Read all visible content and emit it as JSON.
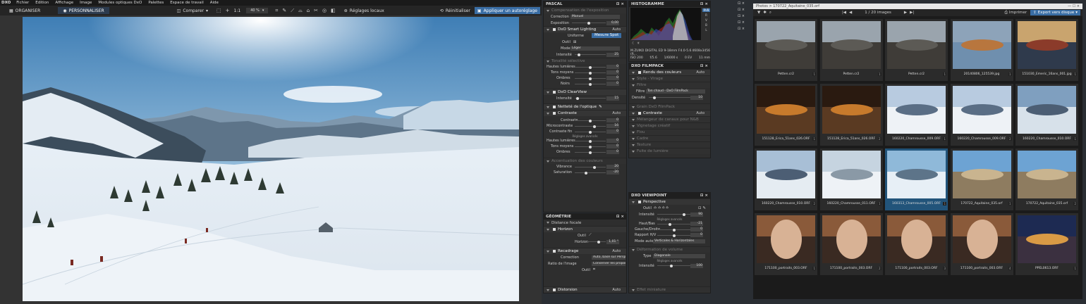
{
  "menubar": {
    "logo": "DXO",
    "items": [
      "Fichier",
      "Edition",
      "Affichage",
      "Image",
      "Modules optiques DxO",
      "Palettes",
      "Espace de travail",
      "Aide"
    ]
  },
  "toolbar": {
    "organize": "ORGANISER",
    "customize": "PERSONNALISER",
    "compare": "Comparer",
    "fit": "1:1",
    "zoom": "40 %",
    "local": "Réglages locaux",
    "reset": "Réinitialiser",
    "apply": "Appliquer un autoréglage"
  },
  "pascal": {
    "title": "PASCAL",
    "exposure_comp": "Compensation de l'exposition",
    "correction_label": "Correction",
    "correction_value": "Manuel",
    "exposure_label": "Exposition",
    "exposure_value": "0,00",
    "smart_lighting": "DxO Smart Lighting",
    "auto": "Auto",
    "uniform": "Uniforme",
    "spot": "Mesure Spot",
    "tool_label": "Outil",
    "mode_label": "Mode",
    "mode_value": "Léger",
    "intensity_label": "Intensité",
    "intensity_value": "25",
    "selective_tone": "Tonalité sélective",
    "tones": [
      {
        "label": "Hautes lumières",
        "value": "0"
      },
      {
        "label": "Tons moyens",
        "value": "0"
      },
      {
        "label": "Ombres",
        "value": "0"
      },
      {
        "label": "Noirs",
        "value": "0"
      }
    ],
    "clearview": "DxO ClearView",
    "clearview_intensity": "15",
    "sharpness": "Netteté de l'optique",
    "contrast": "Contraste",
    "contrast_rows": [
      {
        "label": "Contraste",
        "value": "0"
      },
      {
        "label": "Microcontraste",
        "value": "16"
      },
      {
        "label": "Contraste fin",
        "value": "0"
      }
    ],
    "advanced": "Réglages avancés",
    "contrast_adv": [
      {
        "label": "Hautes lumières",
        "value": "0"
      },
      {
        "label": "Tons moyens",
        "value": "0"
      },
      {
        "label": "Ombres",
        "value": "0"
      }
    ],
    "color_accent": "Accentuation des couleurs",
    "vibrance_label": "Vibrance",
    "vibrance_value": "20",
    "saturation_label": "Saturation",
    "saturation_value": "-20"
  },
  "geometry": {
    "title": "GÉOMÉTRIE",
    "focal": "Distance focale",
    "horizon": "Horizon",
    "tool_label": "Outil",
    "horizon_label": "Horizon",
    "horizon_value": "1,01 °",
    "crop": "Recadrage",
    "auto": "Auto",
    "correction_label": "Correction",
    "correction_value": "Auto, basé sur Perspective/Vo",
    "ratio_label": "Ratio de l'image",
    "ratio_value": "Conserver les proportions",
    "distortion": "Distorsion"
  },
  "histogram": {
    "title": "HISTOGRAMME",
    "channels": [
      "RVB",
      "R",
      "V",
      "B",
      "L"
    ],
    "lens": "M.ZUIKO DIGITAL ED 9-18mm F4.0-5.6 (R...",
    "dims": "4608x3456",
    "iso": "ISO 200",
    "aperture": "f/5.6",
    "speed": "1/6000 s",
    "ev": "0 EV",
    "focal": "11 mm"
  },
  "filmpack": {
    "title": "DXO FILMPACK",
    "color_render": "Rendu des couleurs",
    "auto": "Auto",
    "style": "Style - Virage",
    "filter": "Filtre",
    "filter_label": "Filtre",
    "filter_value": "Ton chaud - DxO FilmPack",
    "density_label": "Densité",
    "density_value": "10",
    "grain": "Grain DxO FilmPack",
    "contrast": "Contraste",
    "dim_items": [
      "Mélangeur de canaux pour N&B",
      "Vignetage créatif",
      "Flou",
      "Cadre",
      "Texture",
      "Fuite de lumière"
    ]
  },
  "viewpoint": {
    "title": "DXO VIEWPOINT",
    "perspective": "Perspective",
    "tool_label": "Outil",
    "intensity_label": "Intensité",
    "intensity_value": "90",
    "advanced": "Réglages avancés",
    "rows": [
      {
        "label": "Haut/Bas",
        "value": "-21"
      },
      {
        "label": "Gauche/Droite",
        "value": "0"
      },
      {
        "label": "Rapport H/V",
        "value": "0"
      }
    ],
    "mode_label": "Mode auto",
    "mode_value": "Verticales & Horizontales",
    "volume": "Déformation de volume",
    "type_label": "Type",
    "type_value": "Diagonale",
    "intensity2_value": "100",
    "fisheye": "Effet miniature"
  },
  "browser": {
    "path": "Photos > 170722_Aquitaine_035.orf",
    "counter": "1 / 20 images",
    "print": "Imprimer",
    "export": "Export vers disque",
    "thumbs": [
      {
        "name": "Petten.cr2",
        "num": "1"
      },
      {
        "name": "Petten.cr2",
        "num": "1"
      },
      {
        "name": "Petten.cr2",
        "num": "1"
      },
      {
        "name": "20140806_125539.jpg",
        "num": "1"
      },
      {
        "name": "151030_Emeric_16ans_001.jpg",
        "num": "1"
      },
      {
        "name": "151128_Erica_51ans_026.ORF",
        "num": "1"
      },
      {
        "name": "151128_Erica_51ans_026.ORF",
        "num": "2"
      },
      {
        "name": "160220_Chamrousse_009.ORF",
        "num": "1"
      },
      {
        "name": "160220_Chamrousse_009.ORF",
        "num": "2"
      },
      {
        "name": "160220_Chamrousse_010.ORF",
        "num": "1"
      },
      {
        "name": "160220_Chamrousse_010.ORF",
        "num": "2"
      },
      {
        "name": "160220_Chamrousse_011.ORF",
        "num": "1"
      },
      {
        "name": "160313_Chamrousse_005.ORF",
        "num": "1"
      },
      {
        "name": "170722_Aquitaine_035.orf",
        "num": "1"
      },
      {
        "name": "170722_Aquitaine_035.orf",
        "num": "2"
      },
      {
        "name": "171100_portraits_003.ORF",
        "num": "1"
      },
      {
        "name": "171100_portraits_003.ORF",
        "num": "2"
      },
      {
        "name": "171100_portraits_003.ORF",
        "num": "3"
      },
      {
        "name": "171100_portraits_003.ORF",
        "num": "4"
      },
      {
        "name": "PPEL0613.ORF",
        "num": "1"
      }
    ]
  },
  "colors": {
    "accent": "#3a6ea5",
    "selected": "#22547a"
  }
}
